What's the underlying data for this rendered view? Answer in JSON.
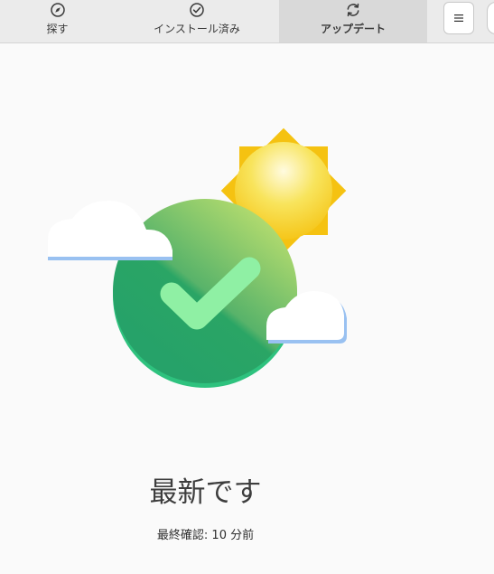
{
  "header": {
    "tabs": [
      {
        "label": "探す",
        "icon": "compass-icon",
        "active": false
      },
      {
        "label": "インストール済み",
        "icon": "check-circle-icon",
        "active": false
      },
      {
        "label": "アップデート",
        "icon": "refresh-icon",
        "active": true
      }
    ],
    "menu_icon": "hamburger-icon"
  },
  "status": {
    "title": "最新です",
    "last_checked": "最終確認: 10 分前"
  },
  "illustration": {
    "elements": [
      "sun",
      "green-checkmark-circle",
      "cloud-left",
      "cloud-right"
    ]
  },
  "colors": {
    "header_bg": "#ebebeb",
    "active_tab_bg": "#d9d9d9",
    "page_bg": "#fafafa",
    "check_green": "#2aa565",
    "sun_yellow": "#f5c211"
  }
}
